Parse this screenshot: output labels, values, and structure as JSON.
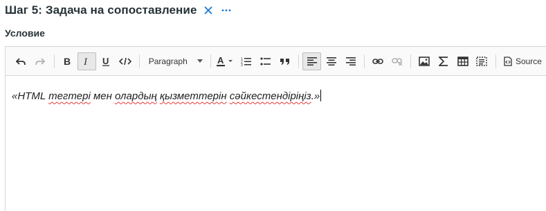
{
  "header": {
    "title": "Шаг 5: Задача на сопоставление",
    "close_icon": "close-icon",
    "more_icon": "more-horizontal-icon",
    "accent_color": "#1976d2"
  },
  "section": {
    "label": "Условие"
  },
  "toolbar": {
    "buttons": [
      {
        "name": "undo",
        "icon": "undo-icon"
      },
      {
        "name": "redo",
        "icon": "redo-icon"
      },
      {
        "name": "bold",
        "icon": "bold-icon"
      },
      {
        "name": "italic",
        "icon": "italic-icon",
        "active": true
      },
      {
        "name": "underline",
        "icon": "underline-icon"
      },
      {
        "name": "code",
        "icon": "code-icon"
      },
      {
        "name": "font-color",
        "icon": "font-color-icon"
      },
      {
        "name": "numbered-list",
        "icon": "numbered-list-icon"
      },
      {
        "name": "bulleted-list",
        "icon": "bulleted-list-icon"
      },
      {
        "name": "blockquote",
        "icon": "quote-icon"
      },
      {
        "name": "align-left",
        "icon": "align-left-icon",
        "active": true
      },
      {
        "name": "align-center",
        "icon": "align-center-icon"
      },
      {
        "name": "align-right",
        "icon": "align-right-icon"
      },
      {
        "name": "link",
        "icon": "link-icon"
      },
      {
        "name": "unlink",
        "icon": "unlink-icon",
        "disabled": true
      },
      {
        "name": "image",
        "icon": "image-icon"
      },
      {
        "name": "math",
        "icon": "sigma-icon"
      },
      {
        "name": "table",
        "icon": "table-icon"
      },
      {
        "name": "select-all",
        "icon": "select-all-icon"
      }
    ],
    "paragraph_label": "Paragraph",
    "source_label": "Source"
  },
  "content": {
    "segments": [
      {
        "text": "«HTML ",
        "spell": false
      },
      {
        "text": "тегтері",
        "spell": true
      },
      {
        "text": " мен ",
        "spell": false
      },
      {
        "text": "олардың",
        "spell": true
      },
      {
        "text": " ",
        "spell": false
      },
      {
        "text": "қызметтерін",
        "spell": true
      },
      {
        "text": " ",
        "spell": false
      },
      {
        "text": "сәйкестендіріңіз",
        "spell": true
      },
      {
        "text": ".»",
        "spell": false
      }
    ]
  }
}
